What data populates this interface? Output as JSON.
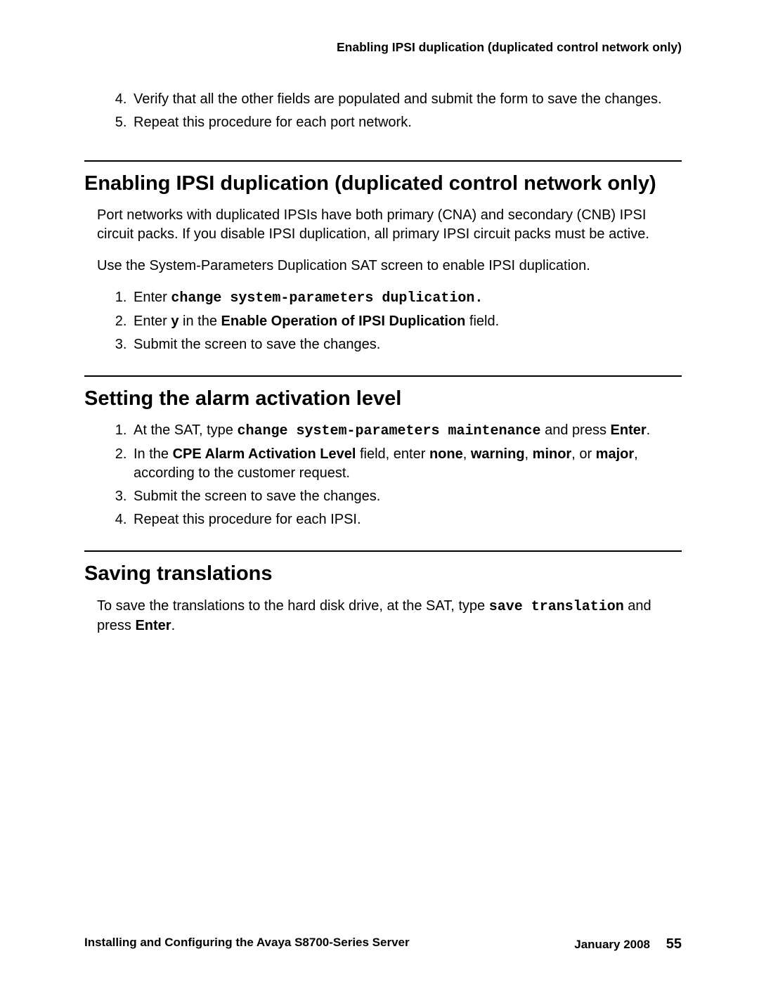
{
  "running_header": "Enabling IPSI duplication (duplicated control network only)",
  "intro_list": {
    "start": 4,
    "items": [
      "Verify that all the other fields are populated and submit the form to save the changes.",
      "Repeat this procedure for each port network."
    ]
  },
  "sec1": {
    "heading": "Enabling IPSI duplication (duplicated control network only)",
    "p1": "Port networks with duplicated IPSIs have both primary (CNA) and secondary (CNB) IPSI circuit packs. If you disable IPSI duplication, all primary IPSI circuit packs must be active.",
    "p2": "Use the System-Parameters Duplication SAT screen to enable IPSI duplication.",
    "step1_lead": "Enter ",
    "step1_cmd": "change system-parameters duplication.",
    "step2_a": "Enter ",
    "step2_b": "y",
    "step2_c": " in the ",
    "step2_d": "Enable Operation of IPSI Duplication",
    "step2_e": " field.",
    "step3": "Submit the screen to save the changes."
  },
  "sec2": {
    "heading": "Setting the alarm activation level",
    "step1_a": "At the SAT, type ",
    "step1_cmd": "change system-parameters maintenance",
    "step1_b": " and press ",
    "step1_c": "Enter",
    "step1_d": ".",
    "step2_a": "In the ",
    "step2_b": "CPE Alarm Activation Level",
    "step2_c": " field, enter ",
    "step2_d": "none",
    "step2_e": ", ",
    "step2_f": "warning",
    "step2_g": ", ",
    "step2_h": "minor",
    "step2_i": ", or ",
    "step2_j": "major",
    "step2_k": ", according to the customer request.",
    "step3": "Submit the screen to save the changes.",
    "step4": "Repeat this procedure for each IPSI."
  },
  "sec3": {
    "heading": "Saving translations",
    "p_a": "To save the translations to the hard disk drive, at the SAT, type ",
    "p_cmd": "save translation",
    "p_b": " and press ",
    "p_c": "Enter",
    "p_d": "."
  },
  "footer": {
    "title": "Installing and Configuring the Avaya S8700-Series Server",
    "date": "January 2008",
    "page": "55"
  }
}
